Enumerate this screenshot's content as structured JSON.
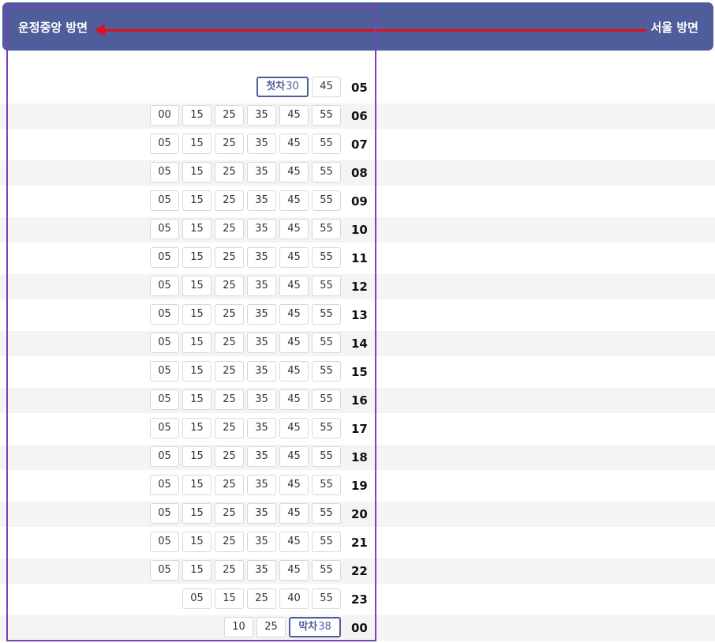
{
  "header": {
    "left_label": "운정중앙 방면",
    "right_label": "서울 방면"
  },
  "colors": {
    "header_bg": "#4f5e9a",
    "arrow": "#e3101f",
    "highlight_border": "#7c3fbd",
    "alt_row_bg": "#f4f4f4"
  },
  "schedule": [
    {
      "hour": "05",
      "minutes": [
        {
          "label": "첫차",
          "value": "30"
        },
        {
          "value": "45"
        }
      ]
    },
    {
      "hour": "06",
      "minutes": [
        {
          "value": "00"
        },
        {
          "value": "15"
        },
        {
          "value": "25"
        },
        {
          "value": "35"
        },
        {
          "value": "45"
        },
        {
          "value": "55"
        }
      ]
    },
    {
      "hour": "07",
      "minutes": [
        {
          "value": "05"
        },
        {
          "value": "15"
        },
        {
          "value": "25"
        },
        {
          "value": "35"
        },
        {
          "value": "45"
        },
        {
          "value": "55"
        }
      ]
    },
    {
      "hour": "08",
      "minutes": [
        {
          "value": "05"
        },
        {
          "value": "15"
        },
        {
          "value": "25"
        },
        {
          "value": "35"
        },
        {
          "value": "45"
        },
        {
          "value": "55"
        }
      ]
    },
    {
      "hour": "09",
      "minutes": [
        {
          "value": "05"
        },
        {
          "value": "15"
        },
        {
          "value": "25"
        },
        {
          "value": "35"
        },
        {
          "value": "45"
        },
        {
          "value": "55"
        }
      ]
    },
    {
      "hour": "10",
      "minutes": [
        {
          "value": "05"
        },
        {
          "value": "15"
        },
        {
          "value": "25"
        },
        {
          "value": "35"
        },
        {
          "value": "45"
        },
        {
          "value": "55"
        }
      ]
    },
    {
      "hour": "11",
      "minutes": [
        {
          "value": "05"
        },
        {
          "value": "15"
        },
        {
          "value": "25"
        },
        {
          "value": "35"
        },
        {
          "value": "45"
        },
        {
          "value": "55"
        }
      ]
    },
    {
      "hour": "12",
      "minutes": [
        {
          "value": "05"
        },
        {
          "value": "15"
        },
        {
          "value": "25"
        },
        {
          "value": "35"
        },
        {
          "value": "45"
        },
        {
          "value": "55"
        }
      ]
    },
    {
      "hour": "13",
      "minutes": [
        {
          "value": "05"
        },
        {
          "value": "15"
        },
        {
          "value": "25"
        },
        {
          "value": "35"
        },
        {
          "value": "45"
        },
        {
          "value": "55"
        }
      ]
    },
    {
      "hour": "14",
      "minutes": [
        {
          "value": "05"
        },
        {
          "value": "15"
        },
        {
          "value": "25"
        },
        {
          "value": "35"
        },
        {
          "value": "45"
        },
        {
          "value": "55"
        }
      ]
    },
    {
      "hour": "15",
      "minutes": [
        {
          "value": "05"
        },
        {
          "value": "15"
        },
        {
          "value": "25"
        },
        {
          "value": "35"
        },
        {
          "value": "45"
        },
        {
          "value": "55"
        }
      ]
    },
    {
      "hour": "16",
      "minutes": [
        {
          "value": "05"
        },
        {
          "value": "15"
        },
        {
          "value": "25"
        },
        {
          "value": "35"
        },
        {
          "value": "45"
        },
        {
          "value": "55"
        }
      ]
    },
    {
      "hour": "17",
      "minutes": [
        {
          "value": "05"
        },
        {
          "value": "15"
        },
        {
          "value": "25"
        },
        {
          "value": "35"
        },
        {
          "value": "45"
        },
        {
          "value": "55"
        }
      ]
    },
    {
      "hour": "18",
      "minutes": [
        {
          "value": "05"
        },
        {
          "value": "15"
        },
        {
          "value": "25"
        },
        {
          "value": "35"
        },
        {
          "value": "45"
        },
        {
          "value": "55"
        }
      ]
    },
    {
      "hour": "19",
      "minutes": [
        {
          "value": "05"
        },
        {
          "value": "15"
        },
        {
          "value": "25"
        },
        {
          "value": "35"
        },
        {
          "value": "45"
        },
        {
          "value": "55"
        }
      ]
    },
    {
      "hour": "20",
      "minutes": [
        {
          "value": "05"
        },
        {
          "value": "15"
        },
        {
          "value": "25"
        },
        {
          "value": "35"
        },
        {
          "value": "45"
        },
        {
          "value": "55"
        }
      ]
    },
    {
      "hour": "21",
      "minutes": [
        {
          "value": "05"
        },
        {
          "value": "15"
        },
        {
          "value": "25"
        },
        {
          "value": "35"
        },
        {
          "value": "45"
        },
        {
          "value": "55"
        }
      ]
    },
    {
      "hour": "22",
      "minutes": [
        {
          "value": "05"
        },
        {
          "value": "15"
        },
        {
          "value": "25"
        },
        {
          "value": "35"
        },
        {
          "value": "45"
        },
        {
          "value": "55"
        }
      ]
    },
    {
      "hour": "23",
      "minutes": [
        {
          "value": "05"
        },
        {
          "value": "15"
        },
        {
          "value": "25"
        },
        {
          "value": "40"
        },
        {
          "value": "55"
        }
      ]
    },
    {
      "hour": "00",
      "minutes": [
        {
          "value": "10"
        },
        {
          "value": "25"
        },
        {
          "label": "막차",
          "value": "38"
        }
      ]
    }
  ]
}
